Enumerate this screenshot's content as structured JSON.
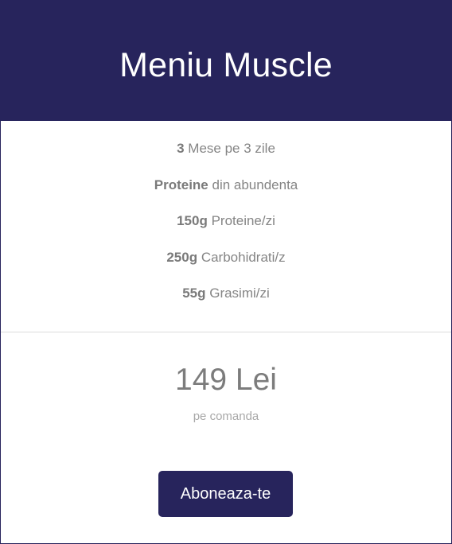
{
  "plan": {
    "title": "Meniu Muscle",
    "features": [
      {
        "bold": "3",
        "text": " Mese pe 3 zile"
      },
      {
        "bold": "Proteine",
        "text": " din abundenta"
      },
      {
        "bold": "150g",
        "text": " Proteine/zi"
      },
      {
        "bold": "250g",
        "text": " Carbohidrati/z"
      },
      {
        "bold": "55g",
        "text": " Grasimi/zi"
      }
    ],
    "price": "149 Lei",
    "price_note": "pe comanda",
    "cta_label": "Aboneaza-te"
  },
  "colors": {
    "brand": "#27245c",
    "text_muted": "#858585",
    "divider": "#dcdcdc"
  }
}
